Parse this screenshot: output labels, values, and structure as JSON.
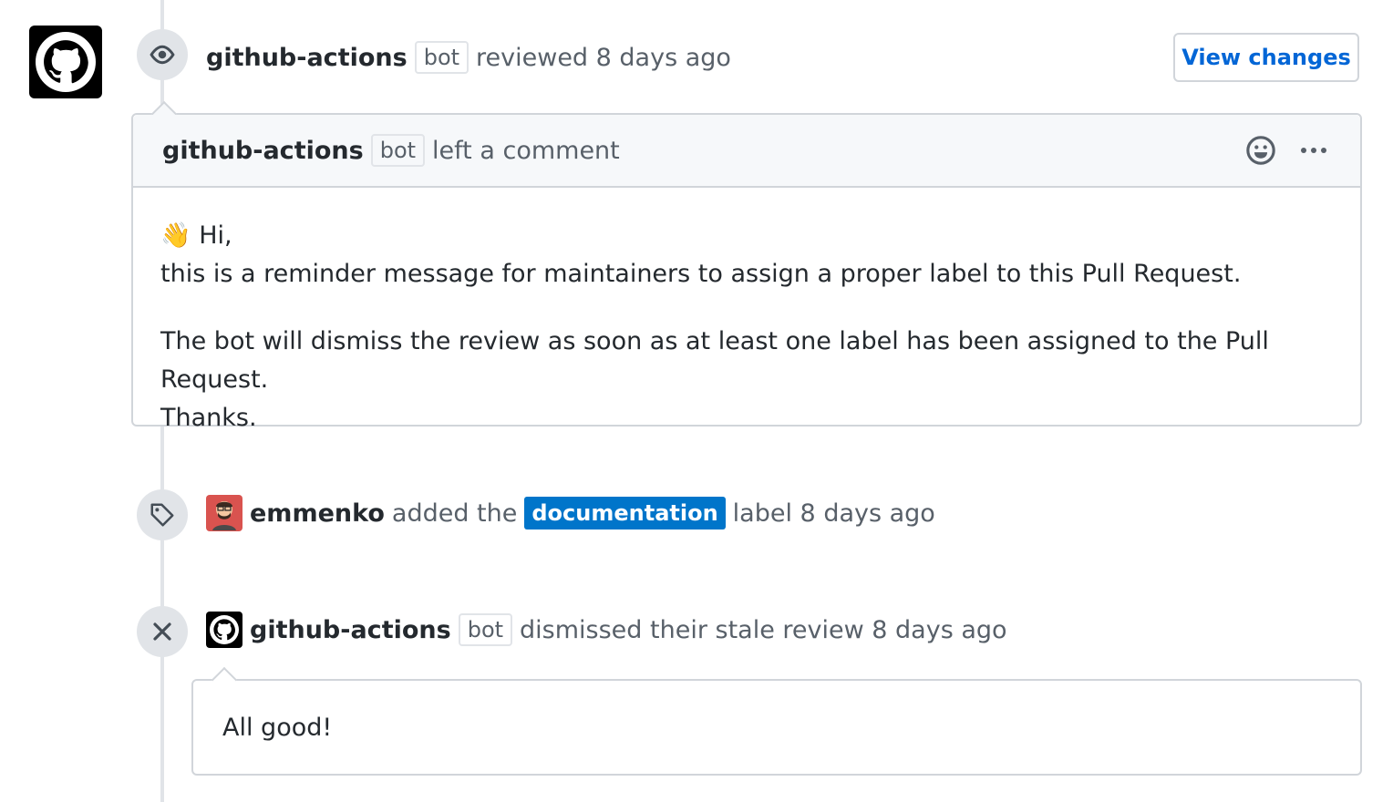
{
  "review_event": {
    "author": "github-actions",
    "bot_tag": "bot",
    "action": "reviewed 8 days ago",
    "view_changes_label": "View changes"
  },
  "comment": {
    "author": "github-actions",
    "bot_tag": "bot",
    "action": "left a comment",
    "greeting_emoji": "👋",
    "greeting": "Hi,",
    "line1": "this is a reminder message for maintainers to assign a proper label to this Pull Request.",
    "line2": "The bot will dismiss the review as soon as at least one label has been assigned to the Pull Request.",
    "line3": "Thanks."
  },
  "label_event": {
    "author": "emmenko",
    "action_before": "added the",
    "label": "documentation",
    "label_color": "#0075ca",
    "action_after": "label 8 days ago"
  },
  "dismiss_event": {
    "author": "github-actions",
    "bot_tag": "bot",
    "action": "dismissed their stale review 8 days ago",
    "message": "All good!"
  },
  "colors": {
    "link": "#0366d6",
    "timeline": "#e1e4e8",
    "border": "#d1d5da"
  }
}
